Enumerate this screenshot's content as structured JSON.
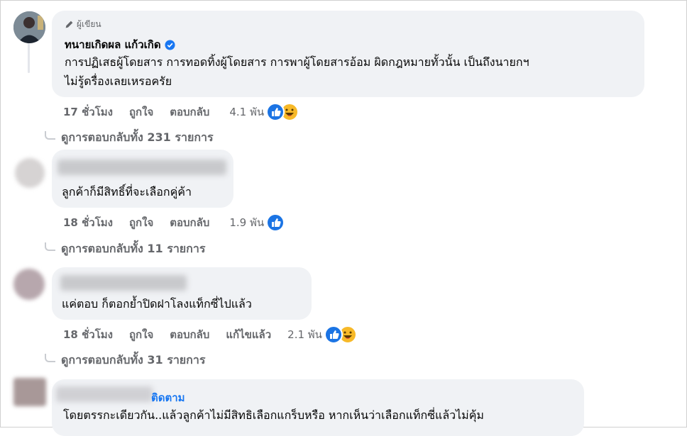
{
  "comments": [
    {
      "badge": "ผู้เขียน",
      "name": "ทนายเกิดผล แก้วเกิด",
      "lines": [
        "การปฏิเสธผู้โดยสาร การทอดทิ้งผู้โดยสาร การพาผู้โดยสารอ้อม ผิดกฎหมายทั้วนั้น เป็นถึงนายกฯ",
        "ไม่รู้ดรื่องเลยเหรอครัย"
      ],
      "time": "17 ชั่วโมง",
      "like": "ถูกใจ",
      "reply": "ตอบกลับ",
      "reactions": "4.1 พัน",
      "view_replies": "ดูการตอบกลับทั้ง 231 รายการ"
    },
    {
      "lines": [
        "ลูกค้าก็มีสิทธิ์ที่จะเลือกคู่ค้า"
      ],
      "time": "18 ชั่วโมง",
      "like": "ถูกใจ",
      "reply": "ตอบกลับ",
      "reactions": "1.9 พัน",
      "view_replies": "ดูการตอบกลับทั้ง 11 รายการ"
    },
    {
      "lines": [
        "แค่ตอบ ก็ตอกย้ำปิดฝาโลงแท็กซี่ไปแล้ว"
      ],
      "time": "18 ชั่วโมง",
      "like": "ถูกใจ",
      "reply": "ตอบกลับ",
      "edited": "แก้ไขแล้ว",
      "reactions": "2.1 พัน",
      "view_replies": "ดูการตอบกลับทั้ง 31 รายการ"
    },
    {
      "follow": "ติดตาม",
      "lines": [
        "โดยตรรกะเดียวกัน..แล้วลูกค้าไม่มีสิทธิเลือกแกร็บหรือ หากเห็นว่าเลือกแท็กซี่แล้วไม่คุ้ม"
      ]
    }
  ],
  "colors": {
    "like": "#1b74e4",
    "haha": "#f7b928",
    "link": "#1877f2",
    "muted": "#65676b",
    "bubble": "#f0f2f5"
  },
  "icons": [
    "pencil-icon",
    "verified-badge-icon",
    "like-reaction-icon",
    "haha-reaction-icon"
  ]
}
